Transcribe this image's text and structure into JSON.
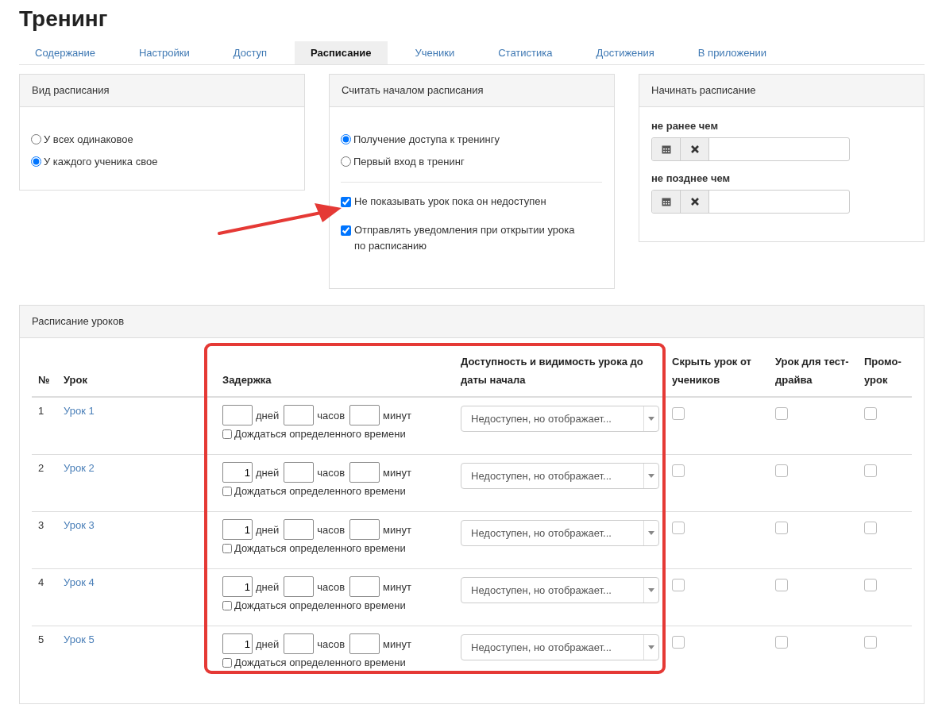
{
  "title": "Тренинг",
  "tabs": [
    {
      "label": "Содержание",
      "selected": false
    },
    {
      "label": "Настройки",
      "selected": false
    },
    {
      "label": "Доступ",
      "selected": false
    },
    {
      "label": "Расписание",
      "selected": true
    },
    {
      "label": "Ученики",
      "selected": false
    },
    {
      "label": "Статистика",
      "selected": false
    },
    {
      "label": "Достижения",
      "selected": false
    },
    {
      "label": "В приложении",
      "selected": false
    }
  ],
  "schedule_type": {
    "title": "Вид расписания",
    "options": [
      {
        "label": "У всех одинаковое",
        "selected": false
      },
      {
        "label": "У каждого ученика свое",
        "selected": true
      }
    ]
  },
  "schedule_start": {
    "title": "Считать началом расписания",
    "options": [
      {
        "label": "Получение доступа к тренингу",
        "selected": true
      },
      {
        "label": "Первый вход в тренинг",
        "selected": false
      }
    ],
    "checkboxes": [
      {
        "label": "Не показывать урок пока он недоступен",
        "checked": true
      },
      {
        "label": "Отправлять уведомления при открытии урока по расписанию",
        "checked": true
      }
    ]
  },
  "start_limits": {
    "title": "Начинать расписание",
    "fields": [
      {
        "label": "не ранее чем"
      },
      {
        "label": "не позднее чем"
      }
    ]
  },
  "lessons": {
    "title": "Расписание уроков",
    "columns": [
      "№",
      "Урок",
      "Задержка",
      "Доступность и видимость урока до даты начала",
      "Скрыть урок от учеников",
      "Урок для тест-драйва",
      "Промо-урок"
    ],
    "rows": [
      {
        "number": "1",
        "lesson": "Урок 1",
        "days": "",
        "days_label": "дней",
        "hours_label": "часов",
        "minutes_label": "минут",
        "wait_label": "Дождаться определенного времени",
        "wait_checked": false,
        "availability": "Недоступен, но отображает...",
        "hidden": false,
        "test_drive": false,
        "promo": false
      },
      {
        "number": "2",
        "lesson": "Урок 2",
        "days": "1",
        "days_label": "дней",
        "hours_label": "часов",
        "minutes_label": "минут",
        "wait_label": "Дождаться определенного времени",
        "wait_checked": false,
        "availability": "Недоступен, но отображает...",
        "hidden": false,
        "test_drive": false,
        "promo": false
      },
      {
        "number": "3",
        "lesson": "Урок 3",
        "days": "1",
        "days_label": "дней",
        "hours_label": "часов",
        "minutes_label": "минут",
        "wait_label": "Дождаться определенного времени",
        "wait_checked": false,
        "availability": "Недоступен, но отображает...",
        "hidden": false,
        "test_drive": false,
        "promo": false
      },
      {
        "number": "4",
        "lesson": "Урок 4",
        "days": "1",
        "days_label": "дней",
        "hours_label": "часов",
        "minutes_label": "минут",
        "wait_label": "Дождаться определенного времени",
        "wait_checked": false,
        "availability": "Недоступен, но отображает...",
        "hidden": false,
        "test_drive": false,
        "promo": false
      },
      {
        "number": "5",
        "lesson": "Урок 5",
        "days": "1",
        "days_label": "дней",
        "hours_label": "часов",
        "minutes_label": "минут",
        "wait_label": "Дождаться определенного времени",
        "wait_checked": false,
        "availability": "Недоступен, но отображает...",
        "hidden": false,
        "test_drive": false,
        "promo": false
      }
    ]
  }
}
